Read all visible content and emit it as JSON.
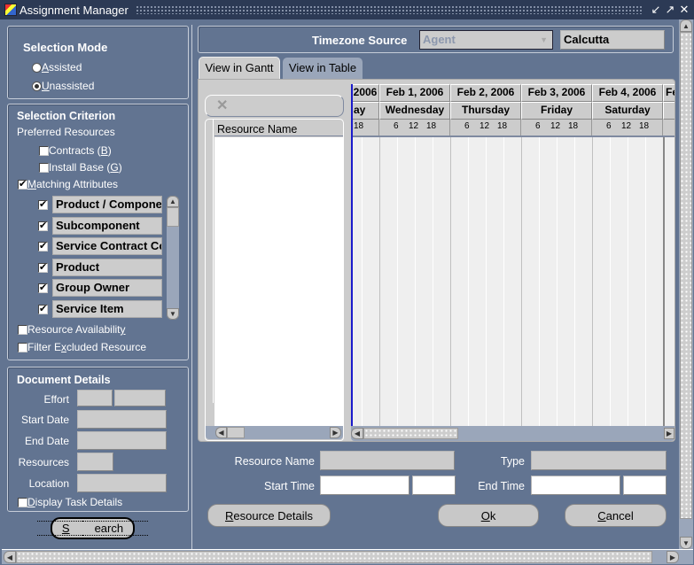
{
  "window": {
    "title": "Assignment Manager",
    "controls": [
      "minimize-icon",
      "maximize-icon",
      "close-icon"
    ],
    "control_glyphs": {
      "minimize": "↙",
      "maximize": "↗",
      "close": "✕"
    }
  },
  "selection_mode": {
    "heading": "Selection Mode",
    "options": [
      {
        "label": "Assisted",
        "mnemonic": "A",
        "rest": "ssisted",
        "selected": false
      },
      {
        "label": "Unassisted",
        "mnemonic": "U",
        "rest": "nassisted",
        "selected": true
      }
    ]
  },
  "selection_criterion": {
    "heading": "Selection Criterion",
    "preferred_resources_label": "Preferred Resources",
    "contracts": {
      "pre": "Contracts  (",
      "mnemonic": "B",
      "post": ")",
      "checked": false
    },
    "install_base": {
      "pre": "Install Base (",
      "mnemonic": "G",
      "post": ")",
      "checked": false
    },
    "matching_attributes": {
      "mnemonic": "M",
      "rest": "atching Attributes",
      "checked": true
    },
    "attributes": [
      {
        "label": "Product / Component",
        "checked": true
      },
      {
        "label": "Subcomponent",
        "checked": true
      },
      {
        "label": "Service Contract Coverage",
        "checked": true
      },
      {
        "label": "Product",
        "checked": true
      },
      {
        "label": "Group Owner",
        "checked": true
      },
      {
        "label": "Service Item",
        "checked": true
      }
    ],
    "resource_availability": {
      "pre": "Resource Availabilit",
      "mnemonic": "y",
      "post": "",
      "checked": false
    },
    "filter_excluded": {
      "pre": "Filter E",
      "mnemonic": "x",
      "post": "cluded Resource",
      "checked": false
    }
  },
  "document_details": {
    "heading": "Document Details",
    "effort_label": "Effort",
    "effort_value": "",
    "effort_unit": "",
    "start_date_label": "Start Date",
    "start_date_value": "",
    "end_date_label": "End Date",
    "end_date_value": "",
    "resources_label": "Resources",
    "resources_value": "",
    "location_label": "Location",
    "location_value": "",
    "display_task_details": {
      "mnemonic": "D",
      "rest": "isplay Task Details",
      "checked": false
    }
  },
  "search_button": {
    "mnemonic": "S",
    "rest": "earch"
  },
  "timezone": {
    "label": "Timezone Source",
    "source_value": "Agent",
    "zone_value": "Calcutta"
  },
  "tabs": [
    {
      "label": "View in Gantt",
      "active": true
    },
    {
      "label": "View in Table",
      "active": false
    }
  ],
  "gantt": {
    "clear_icon": "✕",
    "resource_column_header": "Resource Name",
    "partial_left_day": {
      "date": "2006",
      "weekday": "ay",
      "hours": [
        "18"
      ]
    },
    "days": [
      {
        "date": "Feb 1, 2006",
        "weekday": "Wednesday",
        "hours": [
          "6",
          "12",
          "18"
        ]
      },
      {
        "date": "Feb 2, 2006",
        "weekday": "Thursday",
        "hours": [
          "6",
          "12",
          "18"
        ]
      },
      {
        "date": "Feb 3, 2006",
        "weekday": "Friday",
        "hours": [
          "6",
          "12",
          "18"
        ]
      },
      {
        "date": "Feb 4, 2006",
        "weekday": "Saturday",
        "hours": [
          "6",
          "12",
          "18"
        ]
      }
    ],
    "partial_right_day": {
      "date": "Fe"
    }
  },
  "details": {
    "resource_name_label": "Resource Name",
    "resource_name_value": "",
    "type_label": "Type",
    "type_value": "",
    "start_time_label": "Start Time",
    "start_date_value": "",
    "start_time_value": "",
    "end_time_label": "End Time",
    "end_date_value": "",
    "end_time_value": ""
  },
  "buttons": {
    "resource_details": {
      "mnemonic": "R",
      "rest": "esource Details"
    },
    "ok": {
      "mnemonic": "O",
      "rest": "k"
    },
    "cancel": {
      "mnemonic": "C",
      "rest": "ancel"
    }
  }
}
